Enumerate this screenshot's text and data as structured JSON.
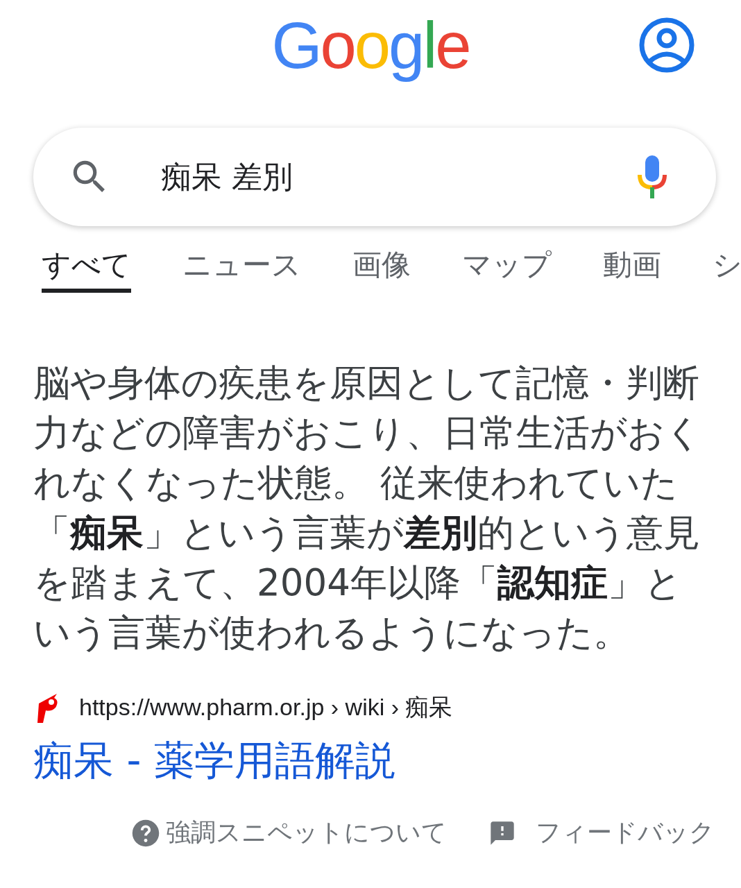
{
  "logo": "Google",
  "search": {
    "value": "痴呆 差別"
  },
  "tabs": [
    {
      "label": "すべて",
      "selected": true
    },
    {
      "label": "ニュース",
      "selected": false
    },
    {
      "label": "画像",
      "selected": false
    },
    {
      "label": "マップ",
      "selected": false
    },
    {
      "label": "動画",
      "selected": false
    },
    {
      "label": "シ",
      "selected": false
    }
  ],
  "snippet": {
    "text": "脳や身体の疾患を原因として記憶・判断力などの障害がおこり、日常生活がおくれなくなった状態。 従来使われていた「**痴呆**」という言葉が**差別**的という意見を踏まえて、2004年以降「**認知症**」という言葉が使われるようになった。",
    "url": "https://www.pharm.or.jp › wiki › 痴呆",
    "title": "痴呆 - 薬学用語解説"
  },
  "footer": {
    "about": "強調スニペットについて",
    "feedback": "フィードバック"
  }
}
